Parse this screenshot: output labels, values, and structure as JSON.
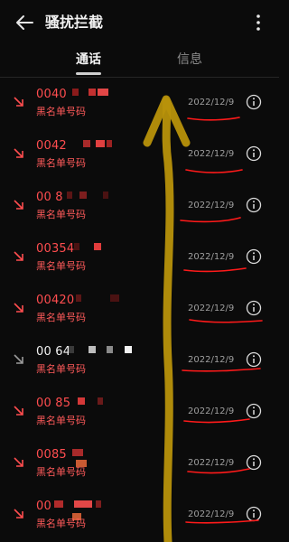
{
  "header": {
    "title": "骚扰拦截",
    "back_icon": "back-arrow-icon",
    "more_icon": "more-vert-icon"
  },
  "tabs": [
    {
      "label": "通话",
      "active": true
    },
    {
      "label": "信息",
      "active": false
    }
  ],
  "calls": [
    {
      "number": "0040",
      "label": "黑名单号码",
      "date": "2022/12/9",
      "type": "blocked"
    },
    {
      "number": "0042",
      "label": "黑名单号码",
      "date": "2022/12/9",
      "type": "blocked"
    },
    {
      "number": "00 8",
      "label": "黑名单号码",
      "date": "2022/12/9",
      "type": "blocked"
    },
    {
      "number": "00354",
      "label": "黑名单号码",
      "date": "2022/12/9",
      "type": "blocked"
    },
    {
      "number": "00420",
      "label": "黑名单号码",
      "date": "2022/12/9",
      "type": "blocked"
    },
    {
      "number": "00 64",
      "label": "黑名单号码",
      "date": "2022/12/9",
      "type": "missed"
    },
    {
      "number": "00 85",
      "label": "黑名单号码",
      "date": "2022/12/9",
      "type": "blocked"
    },
    {
      "number": "0085",
      "label": "黑名单号码",
      "date": "2022/12/9",
      "type": "blocked"
    },
    {
      "number": "00",
      "label": "黑名单号码",
      "date": "2022/12/9",
      "type": "blocked"
    }
  ],
  "colors": {
    "accent": "#ff4d4f",
    "annotation_yellow": "#c9a20a",
    "annotation_red": "#ff1a1a"
  }
}
